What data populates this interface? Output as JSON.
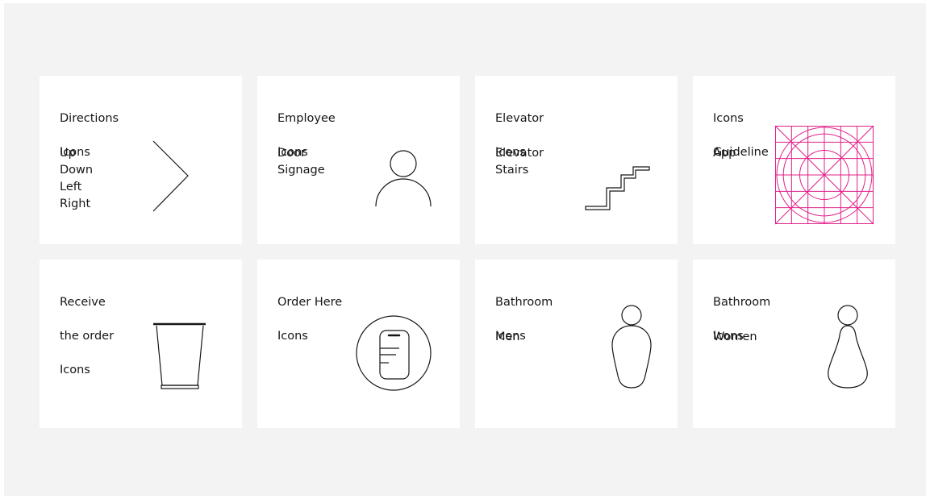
{
  "cards": [
    {
      "title": [
        "Directions",
        "Icons"
      ],
      "items": [
        "Up",
        "Down",
        "Left",
        "Right"
      ],
      "icon": "chevron-right-icon"
    },
    {
      "title": [
        "Employee",
        "Icons"
      ],
      "items": [
        "Door",
        "Signage"
      ],
      "icon": "person-icon"
    },
    {
      "title": [
        "Elevator",
        "Icons"
      ],
      "items": [
        "Elevator",
        "Stairs"
      ],
      "icon": "stairs-icon"
    },
    {
      "title": [
        "Icons",
        "Guideline"
      ],
      "items": [
        "App"
      ],
      "icon": "icon-grid-guideline-icon"
    },
    {
      "title": [
        "Receive",
        "the order",
        "Icons"
      ],
      "items": [],
      "icon": "cup-icon"
    },
    {
      "title": [
        "Order Here",
        "Icons"
      ],
      "items": [],
      "icon": "phone-order-icon"
    },
    {
      "title": [
        "Bathroom",
        "Icons"
      ],
      "items": [
        "Men"
      ],
      "icon": "man-icon"
    },
    {
      "title": [
        "Bathroom",
        "Icons"
      ],
      "items": [
        "Women"
      ],
      "icon": "woman-icon"
    }
  ],
  "colors": {
    "background": "#f4f3f3",
    "card": "#ffffff",
    "text": "#161616",
    "icon_stroke": "#161616",
    "guideline_accent": "#e0218a"
  }
}
